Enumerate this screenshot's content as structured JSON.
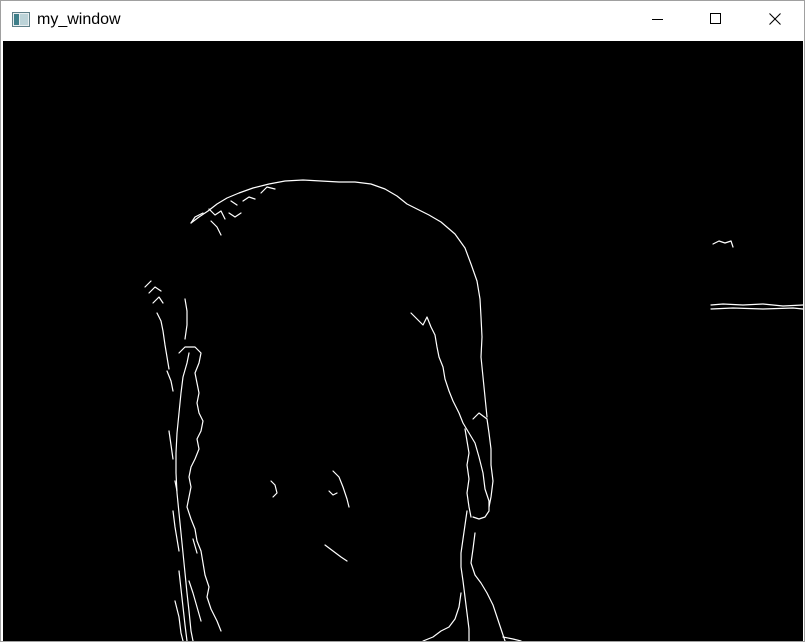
{
  "window": {
    "title": "my_window",
    "icon": "app-window-icon"
  },
  "controls": {
    "minimize_icon": "minimize-icon",
    "maximize_icon": "maximize-icon",
    "close_icon": "close-icon"
  },
  "image": {
    "content": "edge-detection-output",
    "background_color": "#000000",
    "edge_color": "#ffffff"
  }
}
